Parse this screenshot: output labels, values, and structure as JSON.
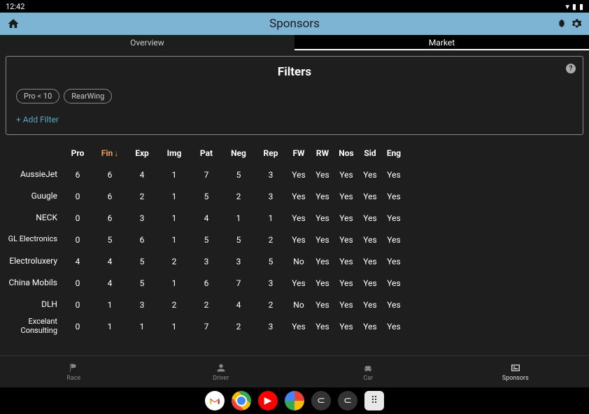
{
  "status": {
    "time": "12:42"
  },
  "appbar": {
    "title": "Sponsors"
  },
  "tabs": {
    "overview": "Overview",
    "market": "Market"
  },
  "filters": {
    "title": "Filters",
    "chip1": "Pro < 10",
    "chip2": "RearWing",
    "add": "+ Add Filter"
  },
  "headers": {
    "pro": "Pro",
    "fin": "Fin",
    "exp": "Exp",
    "img": "Img",
    "pat": "Pat",
    "neg": "Neg",
    "rep": "Rep",
    "fw": "FW",
    "rw": "RW",
    "nos": "Nos",
    "sid": "Sid",
    "eng": "Eng"
  },
  "rows": [
    {
      "name": "AussieJet",
      "pro": "6",
      "fin": "6",
      "exp": "4",
      "img": "1",
      "pat": "7",
      "neg": "5",
      "rep": "3",
      "fw": "Yes",
      "rw": "Yes",
      "nos": "Yes",
      "sid": "Yes",
      "eng": "Yes"
    },
    {
      "name": "Guugle",
      "pro": "0",
      "fin": "6",
      "exp": "2",
      "img": "1",
      "pat": "5",
      "neg": "2",
      "rep": "3",
      "fw": "Yes",
      "rw": "Yes",
      "nos": "Yes",
      "sid": "Yes",
      "eng": "Yes"
    },
    {
      "name": "NECK",
      "pro": "0",
      "fin": "6",
      "exp": "3",
      "img": "1",
      "pat": "4",
      "neg": "1",
      "rep": "1",
      "fw": "Yes",
      "rw": "Yes",
      "nos": "Yes",
      "sid": "Yes",
      "eng": "Yes"
    },
    {
      "name": "GL Electronics",
      "pro": "0",
      "fin": "5",
      "exp": "6",
      "img": "1",
      "pat": "5",
      "neg": "5",
      "rep": "2",
      "fw": "Yes",
      "rw": "Yes",
      "nos": "Yes",
      "sid": "Yes",
      "eng": "Yes",
      "wrap": true
    },
    {
      "name": "Electroluxery",
      "pro": "4",
      "fin": "4",
      "exp": "5",
      "img": "2",
      "pat": "3",
      "neg": "3",
      "rep": "5",
      "fw": "No",
      "rw": "Yes",
      "nos": "Yes",
      "sid": "Yes",
      "eng": "Yes"
    },
    {
      "name": "China Mobils",
      "pro": "0",
      "fin": "4",
      "exp": "5",
      "img": "1",
      "pat": "6",
      "neg": "7",
      "rep": "3",
      "fw": "Yes",
      "rw": "Yes",
      "nos": "Yes",
      "sid": "Yes",
      "eng": "Yes"
    },
    {
      "name": "DLH",
      "pro": "0",
      "fin": "1",
      "exp": "3",
      "img": "2",
      "pat": "2",
      "neg": "4",
      "rep": "2",
      "fw": "No",
      "rw": "Yes",
      "nos": "Yes",
      "sid": "Yes",
      "eng": "Yes"
    },
    {
      "name": "Excelant Consulting",
      "pro": "0",
      "fin": "1",
      "exp": "1",
      "img": "1",
      "pat": "7",
      "neg": "2",
      "rep": "3",
      "fw": "Yes",
      "rw": "Yes",
      "nos": "Yes",
      "sid": "Yes",
      "eng": "Yes",
      "wrap": true
    }
  ],
  "nav": {
    "race": "Race",
    "driver": "Driver",
    "car": "Car",
    "sponsors": "Sponsors"
  }
}
